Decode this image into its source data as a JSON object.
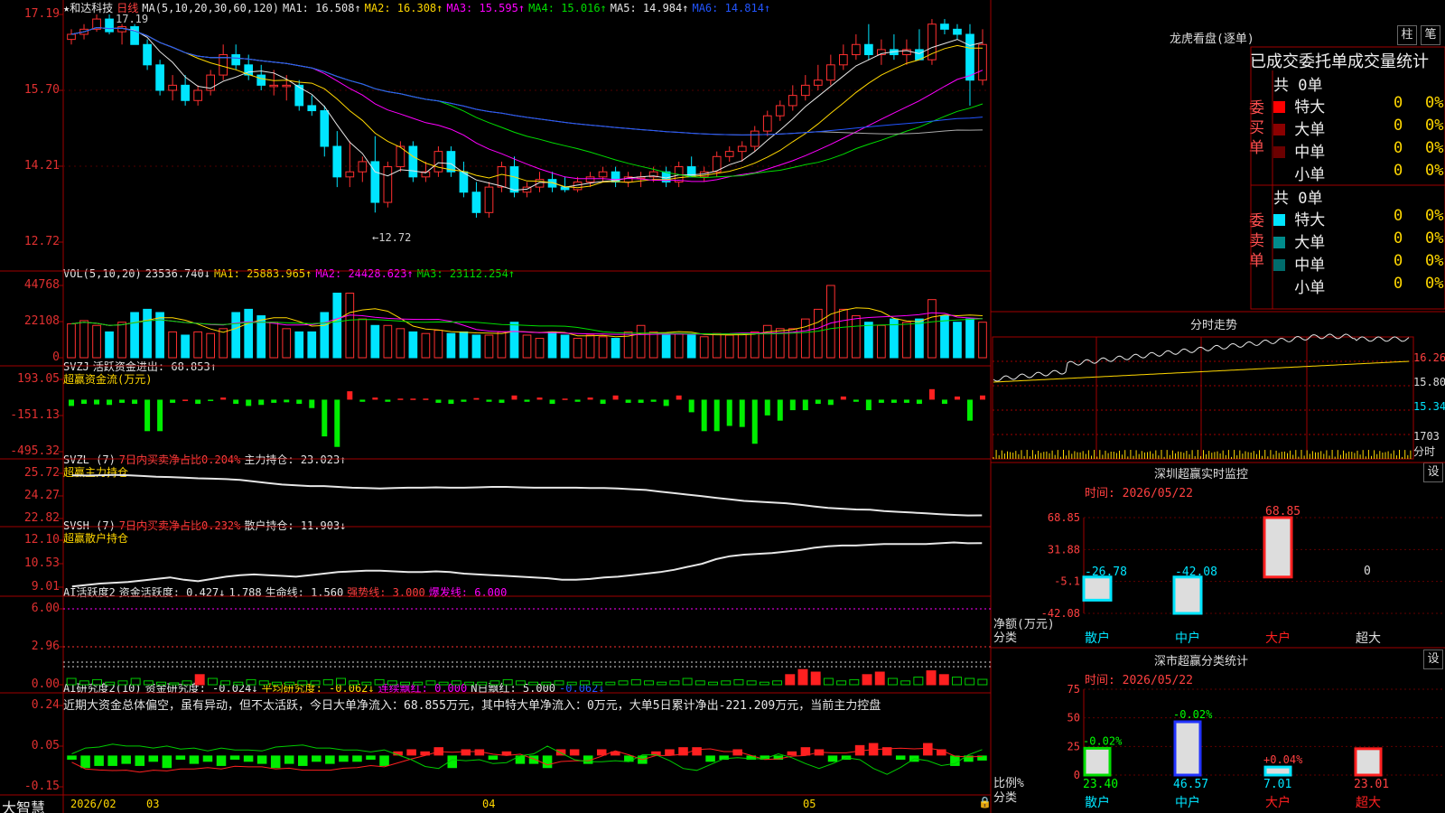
{
  "main": {
    "stock_name": "★和达科技",
    "period": "日线",
    "ma_params": "MA(5,10,20,30,60,120)",
    "ma1": "MA1: 16.508↑",
    "ma2": "MA2: 16.308↑",
    "ma3": "MA3: 15.595↑",
    "ma4": "MA4: 15.016↑",
    "ma5": "MA5: 14.984↑",
    "ma6": "MA6: 14.814↑",
    "high_mark": "17.19",
    "low_mark": "←12.72",
    "y_ticks": [
      "17.19",
      "15.70",
      "14.21",
      "12.72"
    ]
  },
  "vol": {
    "label": "VOL(5,10,20)",
    "val": "23536.740↓",
    "ma1": "MA1: 25883.965↑",
    "ma2": "MA2: 24428.623↑",
    "ma3": "MA3: 23112.254↑",
    "y_ticks": [
      "44768",
      "22108",
      "0"
    ]
  },
  "svzj": {
    "label": "SVZJ",
    "line": "活跃资金进出: 68.853↑",
    "sub": "超赢资金流(万元)",
    "y_ticks": [
      "193.05",
      "-151.13",
      "-495.32"
    ]
  },
  "svzl": {
    "label": "SVZL (7)",
    "net": "7日内买卖净占比0.204%",
    "hold": "主力持仓: 23.023↑",
    "sub": "超赢主力持仓",
    "y_ticks": [
      "25.72",
      "24.27",
      "22.82"
    ]
  },
  "svsh": {
    "label": "SVSH (7)",
    "net": "7日内买卖净占比0.232%",
    "hold": "散户持仓: 11.903↓",
    "sub": "超赢散户持仓",
    "y_ticks": [
      "12.10",
      "10.53",
      "9.01"
    ]
  },
  "ai1": {
    "label": "AI活跃度2",
    "a": "资金活跃度: 0.427↓",
    "b": "1.788",
    "c": "生命线: 1.560",
    "d": "强势线: 3.000",
    "e": "爆发线: 6.000",
    "y_ticks": [
      "6.00",
      "2.96",
      "0.00"
    ]
  },
  "ai2": {
    "label": "AI研究度2(10)",
    "a": "资金研究度: -0.024↓",
    "b": "平均研究度: -0.062↓",
    "c": "连续飘红: 0.000",
    "d": "N日飘红: 5.000",
    "e": "-0.062↓",
    "comment": "近期大资金总体偏空，虽有异动，但不太活跃，今日大单净流入：68.855万元，其中特大单净流入：0万元，大单5日累计净出-221.209万元，当前主力控盘",
    "y_ticks": [
      "0.24",
      "0.05",
      "-0.15"
    ]
  },
  "footer": {
    "brand": "大智慧",
    "dates": [
      "2026/02",
      "03",
      "04",
      "05"
    ]
  },
  "right": {
    "lhb_title": "龙虎看盘(逐单)",
    "btn_pillar": "柱",
    "btn_pen": "笔",
    "stats_title": "已成交委托单成交量统计",
    "buy_label": "委买单",
    "sell_label": "委卖单",
    "buy_total": "共 0单",
    "sell_total": "共 0单",
    "sizes": [
      "特大",
      "大单",
      "中单",
      "小单"
    ],
    "zero": "0",
    "pct": "0%",
    "buy_colors": [
      "#ff0000",
      "#8b0000",
      "#6b0000",
      ""
    ],
    "sell_colors": [
      "#00e5ff",
      "#008b8b",
      "#006b6b",
      ""
    ],
    "intraday_title": "分时走势",
    "intraday_y": [
      "16.26",
      "15.80",
      "15.34",
      "1703",
      "分时"
    ],
    "monitor_title": "深圳超赢实时监控",
    "set_btn": "设",
    "time_label": "时间: 2026/05/22",
    "monitor_y": [
      "68.85",
      "31.88",
      "-5.1",
      "-42.08"
    ],
    "net_label": "净额(万元)",
    "cat_label": "分类",
    "categories": [
      "散户",
      "中户",
      "大户",
      "超大"
    ],
    "monitor_values": [
      "-26.78",
      "-42.08",
      "68.85",
      "0"
    ],
    "class_title": "深市超赢分类统计",
    "class_y": [
      "75",
      "50",
      "25",
      "0"
    ],
    "ratio_label": "比例%",
    "class_values": [
      "23.40",
      "46.57",
      "7.01",
      "23.01"
    ],
    "class_changes": [
      "-0.02%",
      "-0.02%",
      "+0.04%",
      ""
    ]
  },
  "chart_data": [
    {
      "type": "candlestick",
      "title": "和达科技 日线",
      "ylim": [
        12.72,
        17.19
      ],
      "ohlc": [
        [
          16.7,
          16.9,
          16.6,
          16.8
        ],
        [
          16.8,
          17.0,
          16.7,
          16.9
        ],
        [
          16.9,
          17.19,
          16.85,
          17.1
        ],
        [
          17.1,
          17.19,
          16.8,
          16.85
        ],
        [
          16.85,
          17.0,
          16.6,
          16.95
        ],
        [
          16.95,
          17.0,
          16.6,
          16.6
        ],
        [
          16.6,
          16.7,
          16.1,
          16.2
        ],
        [
          16.2,
          16.3,
          15.6,
          15.7
        ],
        [
          15.7,
          16.0,
          15.5,
          15.8
        ],
        [
          15.8,
          16.0,
          15.4,
          15.5
        ],
        [
          15.5,
          15.8,
          15.4,
          15.7
        ],
        [
          15.7,
          16.1,
          15.6,
          16.0
        ],
        [
          16.0,
          16.6,
          15.9,
          16.4
        ],
        [
          16.4,
          16.6,
          16.1,
          16.2
        ],
        [
          16.2,
          16.4,
          15.9,
          16.0
        ],
        [
          16.0,
          16.2,
          15.7,
          15.8
        ],
        [
          15.8,
          16.1,
          15.6,
          15.8
        ],
        [
          15.8,
          16.0,
          15.5,
          15.8
        ],
        [
          15.8,
          15.9,
          15.3,
          15.4
        ],
        [
          15.4,
          15.6,
          15.2,
          15.3
        ],
        [
          15.3,
          15.4,
          14.4,
          14.6
        ],
        [
          14.6,
          14.9,
          13.8,
          14.0
        ],
        [
          14.0,
          14.7,
          13.8,
          14.1
        ],
        [
          14.1,
          14.4,
          13.9,
          14.3
        ],
        [
          14.3,
          14.8,
          13.3,
          13.5
        ],
        [
          13.5,
          14.3,
          13.4,
          14.2
        ],
        [
          14.2,
          14.7,
          14.1,
          14.6
        ],
        [
          14.6,
          14.7,
          13.9,
          14.0
        ],
        [
          14.0,
          14.3,
          13.9,
          14.1
        ],
        [
          14.1,
          14.6,
          14.0,
          14.5
        ],
        [
          14.5,
          14.6,
          14.0,
          14.1
        ],
        [
          14.1,
          14.3,
          13.6,
          13.7
        ],
        [
          13.7,
          13.9,
          13.2,
          13.3
        ],
        [
          13.3,
          13.9,
          13.2,
          13.8
        ],
        [
          13.8,
          14.3,
          13.7,
          14.2
        ],
        [
          14.2,
          14.4,
          13.6,
          13.7
        ],
        [
          13.7,
          13.9,
          13.6,
          13.8
        ],
        [
          13.8,
          14.1,
          13.7,
          13.95
        ],
        [
          13.95,
          14.1,
          13.7,
          13.8
        ],
        [
          13.8,
          14.0,
          13.7,
          13.75
        ],
        [
          13.75,
          14.0,
          13.7,
          13.9
        ],
        [
          13.9,
          14.1,
          13.8,
          14.0
        ],
        [
          14.0,
          14.2,
          13.9,
          14.1
        ],
        [
          14.1,
          14.2,
          13.8,
          13.9
        ],
        [
          13.9,
          14.1,
          13.8,
          14.0
        ],
        [
          14.0,
          14.1,
          13.8,
          14.0
        ],
        [
          14.0,
          14.2,
          13.9,
          14.1
        ],
        [
          14.1,
          14.2,
          13.8,
          13.9
        ],
        [
          13.9,
          14.3,
          13.8,
          14.2
        ],
        [
          14.2,
          14.4,
          14.0,
          14.0
        ],
        [
          14.0,
          14.2,
          13.9,
          14.1
        ],
        [
          14.1,
          14.5,
          14.0,
          14.4
        ],
        [
          14.4,
          14.6,
          14.3,
          14.5
        ],
        [
          14.5,
          14.7,
          14.3,
          14.6
        ],
        [
          14.6,
          15.0,
          14.5,
          14.9
        ],
        [
          14.9,
          15.3,
          14.8,
          15.2
        ],
        [
          15.2,
          15.5,
          15.1,
          15.4
        ],
        [
          15.4,
          15.8,
          15.3,
          15.6
        ],
        [
          15.6,
          16.0,
          15.5,
          15.8
        ],
        [
          15.8,
          16.2,
          15.7,
          15.9
        ],
        [
          15.9,
          16.4,
          15.8,
          16.2
        ],
        [
          16.2,
          16.6,
          16.1,
          16.4
        ],
        [
          16.4,
          16.8,
          16.3,
          16.6
        ],
        [
          16.6,
          17.0,
          16.3,
          16.4
        ],
        [
          16.4,
          16.7,
          16.2,
          16.5
        ],
        [
          16.5,
          16.8,
          16.3,
          16.4
        ],
        [
          16.4,
          16.7,
          16.2,
          16.5
        ],
        [
          16.5,
          16.9,
          16.3,
          16.3
        ],
        [
          16.3,
          17.1,
          16.2,
          17.0
        ],
        [
          17.0,
          17.1,
          16.8,
          16.9
        ],
        [
          16.9,
          17.0,
          16.7,
          16.8
        ],
        [
          16.8,
          17.0,
          15.4,
          15.9
        ],
        [
          15.9,
          16.9,
          15.8,
          16.6
        ]
      ]
    },
    {
      "type": "bar",
      "title": "VOL(5,10,20)",
      "ylim": [
        0,
        44768
      ],
      "values": [
        21000,
        23000,
        20000,
        16000,
        22000,
        28000,
        30000,
        28000,
        16000,
        14000,
        16000,
        15000,
        18000,
        28000,
        30000,
        26000,
        22000,
        18000,
        16000,
        16000,
        28000,
        40000,
        40000,
        24000,
        20000,
        20000,
        18000,
        16000,
        15000,
        17000,
        15000,
        16000,
        14000,
        14000,
        16000,
        22000,
        14000,
        12000,
        16000,
        14000,
        12000,
        14000,
        13000,
        12000,
        16000,
        20000,
        16000,
        14000,
        15000,
        14000,
        13000,
        15000,
        14000,
        15000,
        16000,
        20000,
        18000,
        18000,
        24000,
        30000,
        44768,
        30000,
        26000,
        22000,
        20000,
        24000,
        22000,
        24000,
        36000,
        26000,
        22000,
        24000,
        22000
      ]
    },
    {
      "type": "bar",
      "title": "活跃资金进出",
      "ylim": [
        -495.32,
        193.05
      ],
      "values": [
        -60,
        -40,
        -45,
        -50,
        -30,
        -40,
        -300,
        -300,
        -30,
        0,
        -40,
        -10,
        20,
        -40,
        -60,
        -50,
        -30,
        -25,
        -40,
        -80,
        -350,
        -450,
        80,
        -20,
        20,
        -20,
        10,
        10,
        10,
        -30,
        -40,
        -20,
        15,
        -20,
        -30,
        40,
        -20,
        20,
        -40,
        10,
        -20,
        20,
        -40,
        40,
        -30,
        -30,
        -20,
        -60,
        40,
        -120,
        -300,
        -300,
        -250,
        -260,
        -420,
        -150,
        -200,
        -100,
        -100,
        -40,
        -50,
        30,
        -20,
        -100,
        -30,
        -30,
        -30,
        -40,
        100,
        -40,
        30,
        -200,
        40
      ]
    },
    {
      "type": "line",
      "title": "主力持仓",
      "ylim": [
        22.82,
        25.72
      ],
      "values": [
        25.6,
        25.58,
        25.6,
        25.62,
        25.6,
        25.55,
        25.5,
        25.48,
        25.45,
        25.4,
        25.38,
        25.35,
        25.3,
        25.2,
        25.1,
        25.0,
        24.95,
        24.9,
        24.9,
        24.85,
        24.8,
        24.78,
        24.75,
        24.78,
        24.8,
        24.8,
        24.82,
        24.8,
        24.8,
        24.82,
        24.85,
        24.85,
        24.82,
        24.8,
        24.8,
        24.8,
        24.8,
        24.78,
        24.78,
        24.75,
        24.7,
        24.65,
        24.55,
        24.45,
        24.35,
        24.25,
        24.15,
        24.05,
        23.95,
        23.9,
        23.85,
        23.8,
        23.7,
        23.6,
        23.5,
        23.45,
        23.4,
        23.38,
        23.3,
        23.25,
        23.2,
        23.15,
        23.1,
        23.05,
        23.02,
        23.023
      ]
    },
    {
      "type": "line",
      "title": "散户持仓",
      "ylim": [
        9.01,
        12.1
      ],
      "values": [
        9.05,
        9.15,
        9.25,
        9.3,
        9.35,
        9.45,
        9.55,
        9.65,
        9.5,
        9.4,
        9.55,
        9.7,
        9.8,
        9.85,
        9.8,
        9.75,
        9.7,
        9.8,
        9.9,
        10.0,
        10.05,
        10.1,
        10.1,
        10.05,
        10.0,
        10.0,
        10.05,
        10.0,
        9.9,
        9.85,
        9.8,
        9.75,
        9.7,
        9.65,
        9.6,
        9.5,
        9.5,
        9.55,
        9.65,
        9.7,
        9.8,
        9.9,
        10.0,
        10.15,
        10.35,
        10.55,
        10.85,
        11.05,
        11.15,
        11.2,
        11.25,
        11.35,
        11.45,
        11.6,
        11.7,
        11.75,
        11.75,
        11.8,
        11.85,
        11.85,
        11.85,
        11.85,
        11.9,
        11.95,
        11.9,
        11.903
      ]
    },
    {
      "type": "bar",
      "title": "资金活跃度",
      "ylim": [
        0,
        6.0
      ],
      "values": [
        0.5,
        0.3,
        0.4,
        0.2,
        0.3,
        0.5,
        0.3,
        0.2,
        0.1,
        0.3,
        0.8,
        0.5,
        0.3,
        0.2,
        0.4,
        0.3,
        0.2,
        0.2,
        0.3,
        0.3,
        0.4,
        0.5,
        0.3,
        0.2,
        0.4,
        0.3,
        0.2,
        0.2,
        0.3,
        0.2,
        0.3,
        0.2,
        0.2,
        0.3,
        0.4,
        0.3,
        0.2,
        0.2,
        0.3,
        0.2,
        0.3,
        0.2,
        0.2,
        0.3,
        0.4,
        0.3,
        0.2,
        0.3,
        0.5,
        0.3,
        0.2,
        0.3,
        0.4,
        0.3,
        0.2,
        0.3,
        0.8,
        1.2,
        1.0,
        0.5,
        0.3,
        0.4,
        0.8,
        1.0,
        0.5,
        0.3,
        0.6,
        1.1,
        0.8,
        0.6,
        0.5,
        0.427
      ]
    },
    {
      "type": "bar",
      "title": "资金研究度",
      "ylim": [
        -0.15,
        0.24
      ],
      "values": [
        -0.02,
        -0.06,
        -0.05,
        -0.05,
        -0.04,
        -0.05,
        -0.03,
        -0.06,
        -0.02,
        -0.04,
        -0.03,
        -0.05,
        -0.02,
        -0.03,
        -0.04,
        -0.06,
        -0.04,
        -0.05,
        -0.03,
        -0.04,
        -0.03,
        -0.03,
        -0.02,
        -0.05,
        0.02,
        0.03,
        0.02,
        0.04,
        -0.06,
        0.03,
        0.03,
        -0.02,
        0.02,
        -0.04,
        -0.04,
        -0.06,
        0.03,
        0.03,
        -0.04,
        0.03,
        0.02,
        -0.03,
        -0.04,
        0.02,
        0.03,
        0.04,
        0.04,
        -0.03,
        -0.02,
        0.03,
        -0.02,
        -0.02,
        -0.02,
        0.02,
        0.04,
        0.03,
        -0.03,
        -0.02,
        0.05,
        0.06,
        0.04,
        -0.02,
        -0.03,
        0.06,
        0.03,
        -0.05,
        -0.03,
        -0.024
      ]
    }
  ]
}
